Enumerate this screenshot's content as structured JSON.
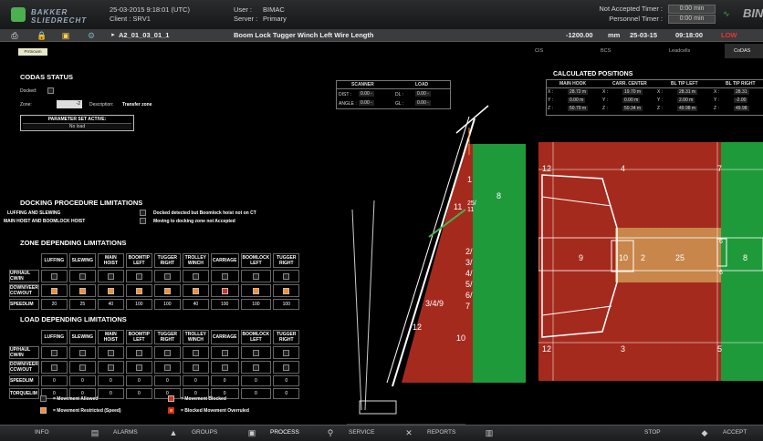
{
  "header": {
    "logo_text": "BAKKER SLIEDRECHT",
    "datetime": "25-03-2015  9:18:01 (UTC)",
    "client": "Client : SRV1",
    "user_label": "User :",
    "user_value": "BIMAC",
    "server_label": "Server :",
    "server_value": "Primary",
    "timer1_label": "Not Accepted Timer :",
    "timer1_value": "0:00  min",
    "timer2_label": "Personnel Timer :",
    "timer2_value": "0:00  min",
    "brand_right": "BIN"
  },
  "toolbar": {
    "breadcrumb": "A2_01_03_01_1",
    "alarm_text": "Boom Lock Tugger Winch Left Wire Length",
    "value": "-1200.00",
    "unit": "mm",
    "date": "25-03-15",
    "time": "09:18:00",
    "status": "LOW"
  },
  "tabs": [
    "CIS",
    "BCS",
    "Leadcells",
    "CoDAS"
  ],
  "pill": "Prrtncwm",
  "codas": {
    "title": "CODAS STATUS",
    "docked_label": "Docked:",
    "zone_label": "Zone:",
    "zone_value": "-2",
    "desc_label": "Description:",
    "desc_value": "Transfer zone",
    "param_label": "PARAMETER SET ACTIVE:",
    "param_value": "No load"
  },
  "scanner": {
    "h1": "SCANNER",
    "h2": "LOAD",
    "r1a": "DIST :",
    "r1b": "0.00  -",
    "r1c": "DL :",
    "r1d": "0.00  -",
    "r2a": "ANGLE :",
    "r2b": "0.00  -",
    "r2c": "GL :",
    "r2d": "0.00  -"
  },
  "calc": {
    "title": "CALCULATED POSITIONS",
    "headers": [
      "MAIN HOOK",
      "CARR. CENTER",
      "BL TIP LEFT",
      "BL TIP RIGHT"
    ],
    "rows": [
      [
        "X :",
        "28.72 m",
        "X :",
        "19.70 m",
        "X :",
        "28.31 m",
        "X :",
        "28.31"
      ],
      [
        "Y :",
        "0.00 m",
        "Y :",
        "0.00 m",
        "Y :",
        "2.00 m",
        "Y :",
        "-2.00"
      ],
      [
        "Z :",
        "50.79 m",
        "Z :",
        "50.34 m",
        "Z :",
        "49.98 m",
        "Z :",
        "49.98"
      ]
    ]
  },
  "docking": {
    "title": "DOCKING PROCEDURE LIMITATIONS",
    "l1": "LUFFING AND SLEWING",
    "l2": "MAIN HOIST AND BOOMLOCK HOIST",
    "r1": "Docked detected but Boomlock hoist not on CT",
    "r2": "Moving to docking zone not Accepted"
  },
  "zone_lim": {
    "title": "ZONE DEPENDING LIMITATIONS",
    "cols": [
      "LUFFING",
      "SLEWING",
      "MAIN HOIST",
      "BOOMTIP LEFT",
      "TUGGER RIGHT",
      "TROLLEY WINCH",
      "CARRIAGE",
      "BOOMLOCK LEFT",
      "TUGGER RIGHT"
    ],
    "rows": [
      "UP/HAUL CW/IN",
      "DOWN/VEER CCW/OUT",
      "SPEEDLIM"
    ],
    "speed": [
      "20",
      "25",
      "40",
      "100",
      "100",
      "40",
      "100",
      "100",
      "100"
    ]
  },
  "load_lim": {
    "title": "LOAD DEPENDING LIMITATIONS",
    "cols": [
      "LUFFING",
      "SLEWING",
      "MAIN HOIST",
      "BOOMTIP LEFT",
      "TUGGER RIGHT",
      "TROLLEY WINCH",
      "CARRIAGE",
      "BOOMLOCK LEFT",
      "TUGGER RIGHT"
    ],
    "rows": [
      "UP/HAUL CW/IN",
      "DOWN/VEER CCW/OUT",
      "SPEEDLIM",
      "TORQUELIM"
    ],
    "speed": [
      "0",
      "0",
      "0",
      "0",
      "0",
      "0",
      "0",
      "0",
      "0"
    ],
    "torque": [
      "0",
      "0",
      "0",
      "0",
      "0",
      "0",
      "0",
      "0",
      "0"
    ]
  },
  "legend": {
    "allowed": "= Movement Allowed",
    "restricted": "= Movement Restricted (Speed)",
    "blocked": "= Movement Blocked",
    "overruled": "= Blocked Movement Overruled"
  },
  "zones_side": [
    "1",
    "8",
    "11",
    "25/ 11",
    "2/ 3/ 4/ 5/ 6/ 7",
    "3/4/9",
    "12",
    "10"
  ],
  "zones_top": [
    "12",
    "4",
    "7",
    "9",
    "10",
    "2",
    "25",
    "6",
    "6",
    "8",
    "12",
    "3",
    "5"
  ],
  "bottom": [
    "INFO",
    "ALARMS",
    "GROUPS",
    "PROCESS",
    "SERVICE",
    "REPORTS",
    "STOP",
    "ACCEPT"
  ],
  "colors": {
    "red": "#a52a1e",
    "green": "#1f9a3a",
    "orange": "#ff8c2a",
    "tan": "#c8864a"
  }
}
